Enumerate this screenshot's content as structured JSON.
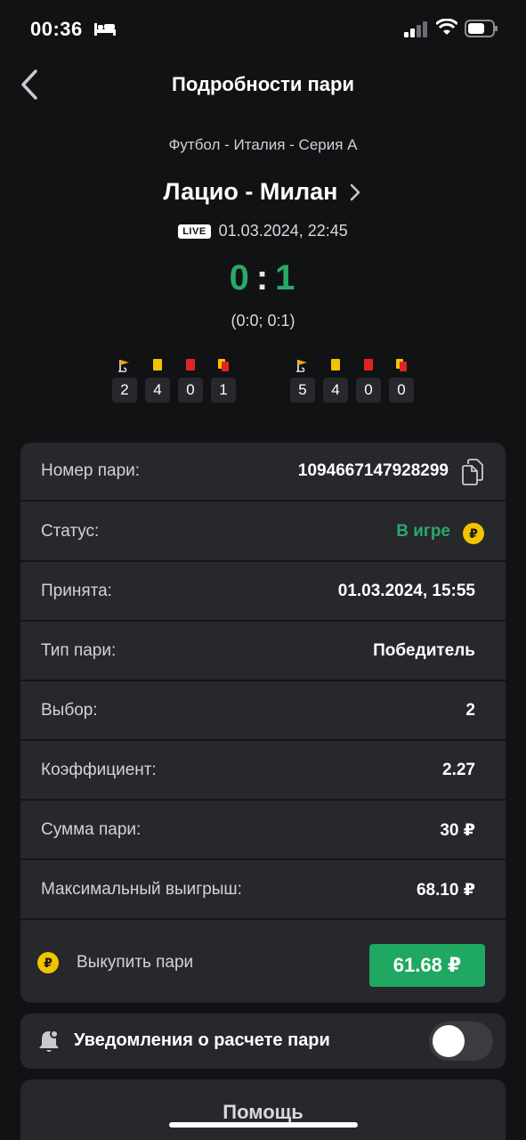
{
  "status_bar": {
    "time": "00:36"
  },
  "nav": {
    "title": "Подробности пари"
  },
  "match": {
    "league": "Футбол - Италия - Серия А",
    "name": "Лацио - Милан",
    "live_badge": "LIVE",
    "datetime": "01.03.2024, 22:45",
    "score_home": "0",
    "score_separator": ":",
    "score_away": "1",
    "half_score": "(0:0; 0:1)"
  },
  "stats": {
    "home": [
      {
        "icon": "corner-flag-icon",
        "value": "2"
      },
      {
        "icon": "yellow-card-icon",
        "value": "4"
      },
      {
        "icon": "red-card-icon",
        "value": "0"
      },
      {
        "icon": "second-yellow-card-icon",
        "value": "1"
      }
    ],
    "away": [
      {
        "icon": "corner-flag-icon",
        "value": "5"
      },
      {
        "icon": "yellow-card-icon",
        "value": "4"
      },
      {
        "icon": "red-card-icon",
        "value": "0"
      },
      {
        "icon": "second-yellow-card-icon",
        "value": "0"
      }
    ]
  },
  "bet": {
    "rows": [
      {
        "label": "Номер пари:",
        "value": "1094667147928299"
      },
      {
        "label": "Статус:",
        "value": "В игре"
      },
      {
        "label": "Принята:",
        "value": "01.03.2024, 15:55"
      },
      {
        "label": "Тип пари:",
        "value": "Победитель"
      },
      {
        "label": "Выбор:",
        "value": "2"
      },
      {
        "label": "Коэффициент:",
        "value": "2.27"
      },
      {
        "label": "Сумма пари:",
        "value": "30 ₽"
      },
      {
        "label": "Максимальный выигрыш:",
        "value": "68.10 ₽"
      }
    ],
    "coin_symbol": "₽",
    "cashout_label": "Выкупить пари",
    "cashout_amount": "61.68 ₽"
  },
  "notifications": {
    "label": "Уведомления о расчете пари",
    "enabled": false
  },
  "help": {
    "label": "Помощь"
  },
  "colors": {
    "background": "#111214",
    "card": "#26282c",
    "accent_green": "#1fa861",
    "score_green": "#2aa86a",
    "coin_yellow": "#f2c300",
    "yellow_card": "#f2c300",
    "red_card": "#e02424"
  }
}
